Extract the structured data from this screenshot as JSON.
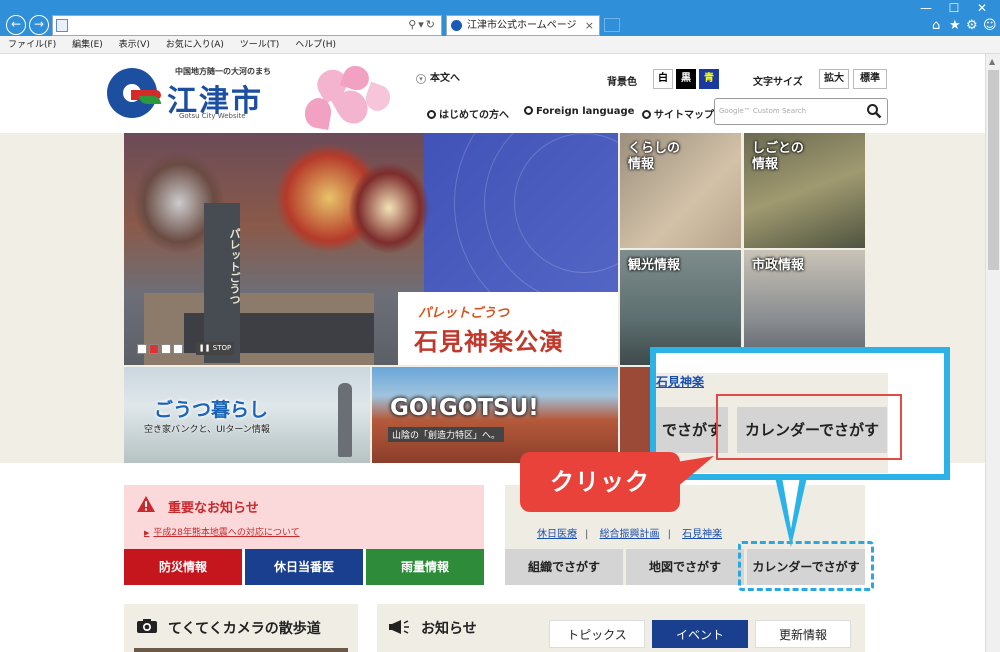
{
  "browser": {
    "address_url": "",
    "tab_title": "江津市公式ホームページ",
    "menu": [
      "ファイル(F)",
      "編集(E)",
      "表示(V)",
      "お気に入り(A)",
      "ツール(T)",
      "ヘルプ(H)"
    ]
  },
  "header": {
    "tagline": "中国地方随一の大河のまち",
    "city_name": "江津市",
    "city_name_en": "Gotsu City Website",
    "skip_link": "本文へ",
    "bg_color_label": "背景色",
    "bg_options": [
      "白",
      "黒",
      "青"
    ],
    "font_size_label": "文字サイズ",
    "font_size_options": [
      "拡大",
      "標準"
    ],
    "nav_links": [
      "はじめての方へ",
      "Foreign language",
      "サイトマップ"
    ],
    "search_placeholder": "Google™ Custom Search"
  },
  "hero": {
    "vertical_text": "パレットごうつ",
    "subtitle": "パレットごうつ",
    "title": "石見神楽公演",
    "stop_label": "STOP",
    "tiles": [
      "くらしの\n情報",
      "しごとの\n情報",
      "観光情報",
      "市政情報"
    ],
    "banner1_title": "ごうつ暮らし",
    "banner1_sub": "空き家バンクと、UIターン情報",
    "banner2_title": "GO!GOTSU!",
    "banner2_sub": "山陰の「創造力特区」へ。"
  },
  "alert": {
    "title": "重要なお知らせ",
    "link": "平成28年熊本地震への対応について",
    "buttons": [
      {
        "label": "防災情報",
        "color": "#c4161c"
      },
      {
        "label": "休日当番医",
        "color": "#1a3f8f"
      },
      {
        "label": "雨量情報",
        "color": "#2e8b3a"
      }
    ]
  },
  "search_panel": {
    "links": [
      "休日医療",
      "総合振興計画",
      "石見神楽"
    ],
    "buttons": [
      "組織でさがす",
      "地図でさがす",
      "カレンダーでさがす"
    ]
  },
  "callout": {
    "header_text": "石見神楽",
    "left_button": "でさがす",
    "right_button": "カレンダーでさがす",
    "click_label": "クリック",
    "accent": "#2bb2e6",
    "highlight": "#e34b47"
  },
  "camera": {
    "title": "てくてくカメラの散歩道"
  },
  "news": {
    "title": "お知らせ",
    "tabs": [
      {
        "label": "トピックス",
        "active": false
      },
      {
        "label": "イベント",
        "active": true
      },
      {
        "label": "更新情報",
        "active": false
      }
    ]
  }
}
